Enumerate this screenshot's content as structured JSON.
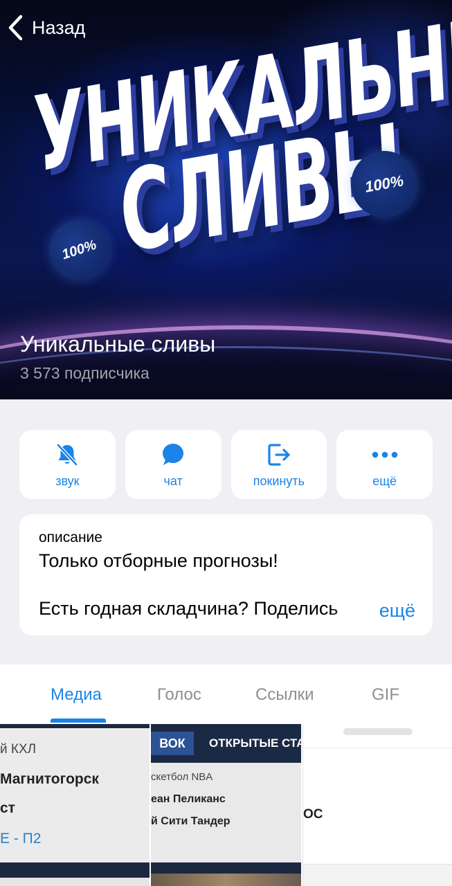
{
  "header": {
    "back_label": "Назад",
    "cover_title_line1": "УНИКАЛЬНЫЕ",
    "cover_title_line2": "СЛИВЫ",
    "badge_text": "100%",
    "channel_title": "Уникальные сливы",
    "subscribers": "3 573 подписчика"
  },
  "actions": [
    {
      "label": "звук",
      "icon": "bell-muted-icon"
    },
    {
      "label": "чат",
      "icon": "chat-bubble-icon"
    },
    {
      "label": "покинуть",
      "icon": "leave-icon"
    },
    {
      "label": "ещё",
      "icon": "more-dots-icon"
    }
  ],
  "description": {
    "label": "описание",
    "line1": "Только отборные прогнозы!",
    "line2": "Есть годная складчина? Поделись",
    "more_label": "ещё"
  },
  "tabs": [
    {
      "label": "Медиа",
      "active": true
    },
    {
      "label": "Голос",
      "active": false
    },
    {
      "label": "Ссылки",
      "active": false
    },
    {
      "label": "GIF",
      "active": false
    }
  ],
  "media": [
    {
      "line1": "й КХЛ",
      "line2": "Магнитогорск",
      "line3": "ст",
      "line4": "Е - П2"
    },
    {
      "header_a": "ВОК",
      "header_b": "ОТКРЫТЫЕ СТА",
      "line1": "скетбол NBA",
      "line2": "еан Пеликанс",
      "line3": "й Сити Тандер"
    },
    {
      "line1": "ОС"
    }
  ],
  "colors": {
    "accent": "#1a84e8",
    "background": "#efeff4",
    "card": "#ffffff",
    "tab_inactive": "#8e8e93"
  }
}
